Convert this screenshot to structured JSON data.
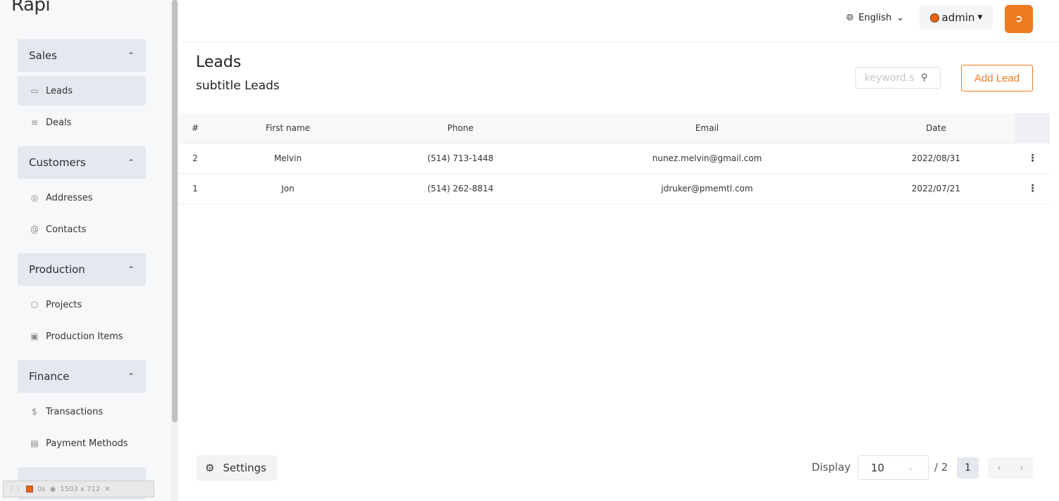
{
  "app": {
    "logo": "Rapi"
  },
  "sidebar": {
    "groups": [
      {
        "label": "Sales",
        "items": [
          {
            "label": "Leads",
            "icon": "book-icon",
            "active": true
          },
          {
            "label": "Deals",
            "icon": "list-icon",
            "active": false
          }
        ]
      },
      {
        "label": "Customers",
        "items": [
          {
            "label": "Addresses",
            "icon": "map-pin-icon"
          },
          {
            "label": "Contacts",
            "icon": "at-icon"
          }
        ]
      },
      {
        "label": "Production",
        "items": [
          {
            "label": "Projects",
            "icon": "box-icon"
          },
          {
            "label": "Production Items",
            "icon": "truck-icon"
          }
        ]
      },
      {
        "label": "Finance",
        "items": [
          {
            "label": "Transactions",
            "icon": "dollar-icon"
          },
          {
            "label": "Payment Methods",
            "icon": "credit-card-icon"
          }
        ]
      }
    ]
  },
  "devbar": {
    "time": "0s",
    "size": "1503 x 712"
  },
  "header": {
    "language": "English",
    "user": "admin"
  },
  "page": {
    "title": "Leads",
    "subtitle": "subtitle Leads",
    "search_placeholder": "keyword.s",
    "add_label": "Add Lead"
  },
  "table": {
    "columns": [
      "#",
      "First name",
      "Phone",
      "Email",
      "Date"
    ],
    "rows": [
      {
        "id": "2",
        "first_name": "Melvin",
        "phone": "(514) 713-1448",
        "email": "nunez.melvin@gmail.com",
        "date": "2022/08/31"
      },
      {
        "id": "1",
        "first_name": "Jon",
        "phone": "(514) 262-8814",
        "email": "jdruker@pmemtl.com",
        "date": "2022/07/21"
      }
    ]
  },
  "footer": {
    "settings_label": "Settings",
    "display_label": "Display",
    "page_size": "10",
    "total_pages": "/ 2",
    "current_page": "1"
  },
  "colors": {
    "accent": "#f07b22",
    "sidebar_bg": "#f6f8fa",
    "group_bg": "#e4e9ef"
  }
}
